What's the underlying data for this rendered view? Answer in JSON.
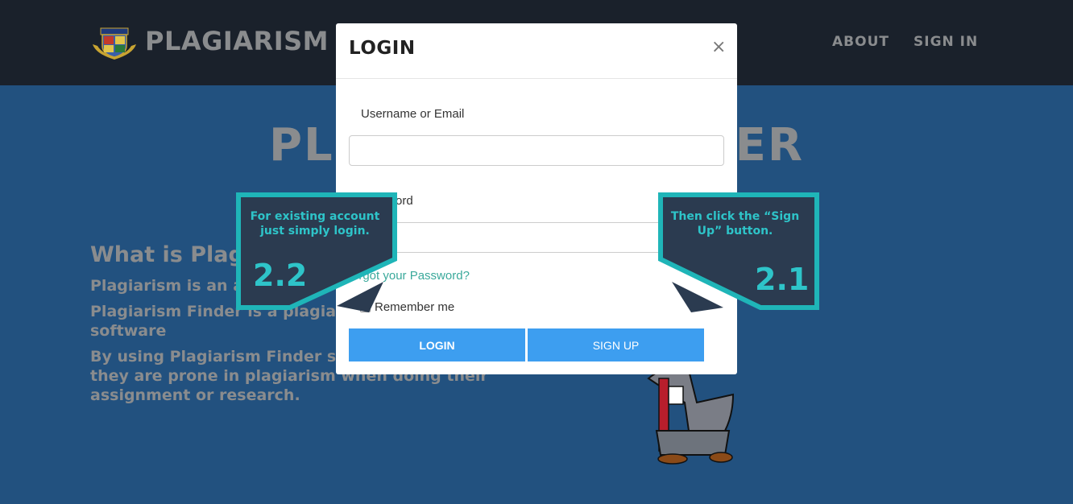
{
  "navbar": {
    "brand": "PLAGIARISM F",
    "links": [
      "ABOUT",
      "SIGN IN"
    ]
  },
  "hero": {
    "title_left": "PL",
    "title_right": "ER",
    "about_heading": "What is Plag",
    "about_lines": [
      "Plagiarism is an a",
      "Plagiarism Finder is a plagiar",
      "software",
      "By using Plagiarism Finder st",
      "they are prone in plagiarism when doing their",
      "assignment or research."
    ]
  },
  "modal": {
    "title": "LOGIN",
    "close": "×",
    "username_label": "Username or Email",
    "password_label": "ord",
    "forgot": "orgot your Password?",
    "remember": "Remember me",
    "login_button": "LOGIN",
    "signup_button": "SIGN UP"
  },
  "callouts": {
    "left": {
      "text": "For existing account just simply login.",
      "number": "2.2"
    },
    "right": {
      "text": "Then click the “Sign Up” button.",
      "number": "2.1"
    }
  },
  "colors": {
    "navbar": "#1a212b",
    "background": "#22517f",
    "button": "#3d9ef0",
    "callout_border": "#1fb5b8",
    "callout_fill": "#2b3b50"
  }
}
